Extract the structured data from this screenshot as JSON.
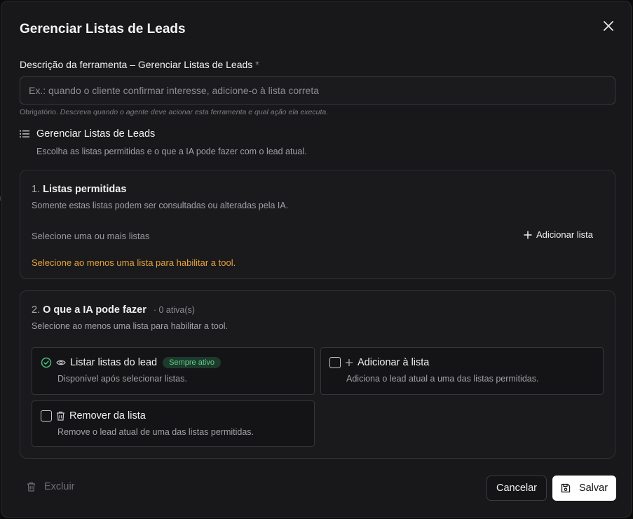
{
  "dialog": {
    "title": "Gerenciar Listas de Leads",
    "close_icon": "close-icon"
  },
  "description_field": {
    "label": "Descrição da ferramenta – Gerenciar Listas de Leads",
    "required_mark": "*",
    "placeholder": "Ex.: quando o cliente confirmar interesse, adicione-o à lista correta",
    "value": "",
    "help_prefix": "Obrigatório.",
    "help_text": "Descreva quando o agente deve acionar esta ferramenta e qual ação ela executa."
  },
  "tool": {
    "icon": "list-icon",
    "name": "Gerenciar Listas de Leads",
    "subtitle": "Escolha as listas permitidas e o que a IA pode fazer com o lead atual."
  },
  "lists_section": {
    "number": "1.",
    "title": "Listas permitidas",
    "subtitle": "Somente estas listas podem ser consultadas ou alteradas pela IA.",
    "select_placeholder": "Selecione uma ou mais listas",
    "add_button": "Adicionar lista",
    "warning": "Selecione ao menos uma lista para habilitar a tool."
  },
  "capabilities_section": {
    "number": "2.",
    "title": "O que a IA pode fazer",
    "active_count": "· 0 ativa(s)",
    "subtitle": "Selecione ao menos uma lista para habilitar a tool.",
    "items": [
      {
        "label": "Listar listas do lead",
        "badge": "Sempre ativo",
        "description": "Disponível após selecionar listas.",
        "icon": "eye-icon",
        "checked": true
      },
      {
        "label": "Adicionar à lista",
        "description": "Adiciona o lead atual a uma das listas permitidas.",
        "icon": "plus-icon",
        "checked": false
      },
      {
        "label": "Remover da lista",
        "description": "Remove o lead atual de uma das listas permitidas.",
        "icon": "trash-icon",
        "checked": false
      }
    ]
  },
  "footer": {
    "delete_label": "Excluir",
    "cancel_label": "Cancelar",
    "save_label": "Salvar"
  },
  "colors": {
    "background": "#18181b",
    "warning": "#e5a33a",
    "badge_text": "#5fd18c",
    "badge_bg": "#1d3a2c",
    "primary_button": "#ffffff"
  }
}
